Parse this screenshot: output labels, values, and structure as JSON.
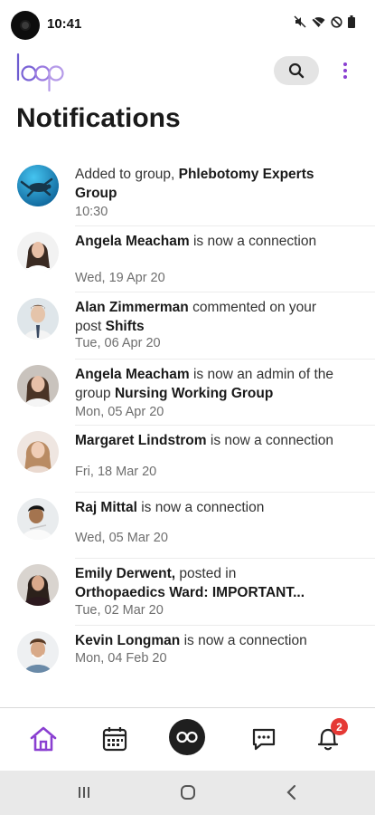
{
  "status_bar": {
    "time": "10:41",
    "icons": [
      "mute-icon",
      "wifi-icon",
      "do-not-disturb-icon",
      "battery-icon"
    ]
  },
  "header": {
    "logo_text": "loop",
    "search_icon": "search-icon",
    "more_icon": "more-vertical-icon"
  },
  "page": {
    "title": "Notifications"
  },
  "notifications": [
    {
      "avatar": "group-avatar-turtle",
      "parts": [
        {
          "t": "Added to group, ",
          "b": false
        },
        {
          "t": "Phlebotomy Experts Group",
          "b": true
        }
      ],
      "time": "10:30"
    },
    {
      "avatar": "avatar-angela",
      "parts": [
        {
          "t": "Angela Meacham",
          "b": true
        },
        {
          "t": " is now a connection",
          "b": false
        }
      ],
      "time": "Wed, 19 Apr 20"
    },
    {
      "avatar": "avatar-alan",
      "parts": [
        {
          "t": "Alan Zimmerman",
          "b": true
        },
        {
          "t": " commented on your post ",
          "b": false
        },
        {
          "t": "Shifts",
          "b": true
        }
      ],
      "time": "Tue, 06 Apr 20"
    },
    {
      "avatar": "avatar-angela-2",
      "parts": [
        {
          "t": "Angela Meacham",
          "b": true
        },
        {
          "t": " is now an admin of the group ",
          "b": false
        },
        {
          "t": "Nursing Working Group",
          "b": true
        }
      ],
      "time": "Mon, 05 Apr 20"
    },
    {
      "avatar": "avatar-margaret",
      "parts": [
        {
          "t": "Margaret Lindstrom",
          "b": true
        },
        {
          "t": " is now a connection",
          "b": false
        }
      ],
      "time": "Fri, 18 Mar 20"
    },
    {
      "avatar": "avatar-raj",
      "parts": [
        {
          "t": "Raj Mittal",
          "b": true
        },
        {
          "t": " is now a connection",
          "b": false
        }
      ],
      "time": "Wed, 05 Mar 20"
    },
    {
      "avatar": "avatar-emily",
      "parts": [
        {
          "t": "Emily Derwent,",
          "b": true
        },
        {
          "t": " posted in ",
          "b": false
        },
        {
          "t": "Orthopaedics Ward: IMPORTANT...",
          "b": true
        }
      ],
      "time": "Tue, 02 Mar 20"
    },
    {
      "avatar": "avatar-kevin",
      "parts": [
        {
          "t": "Kevin Longman",
          "b": true
        },
        {
          "t": " is now a connection",
          "b": false
        }
      ],
      "time": "Mon, 04 Feb 20"
    }
  ],
  "bottom_nav": {
    "items": [
      "home-icon",
      "calendar-icon",
      "loop-icon",
      "chat-icon",
      "bell-icon"
    ],
    "notification_badge": "2"
  },
  "colors": {
    "accent": "#8a3fd1",
    "badge": "#e53935"
  }
}
